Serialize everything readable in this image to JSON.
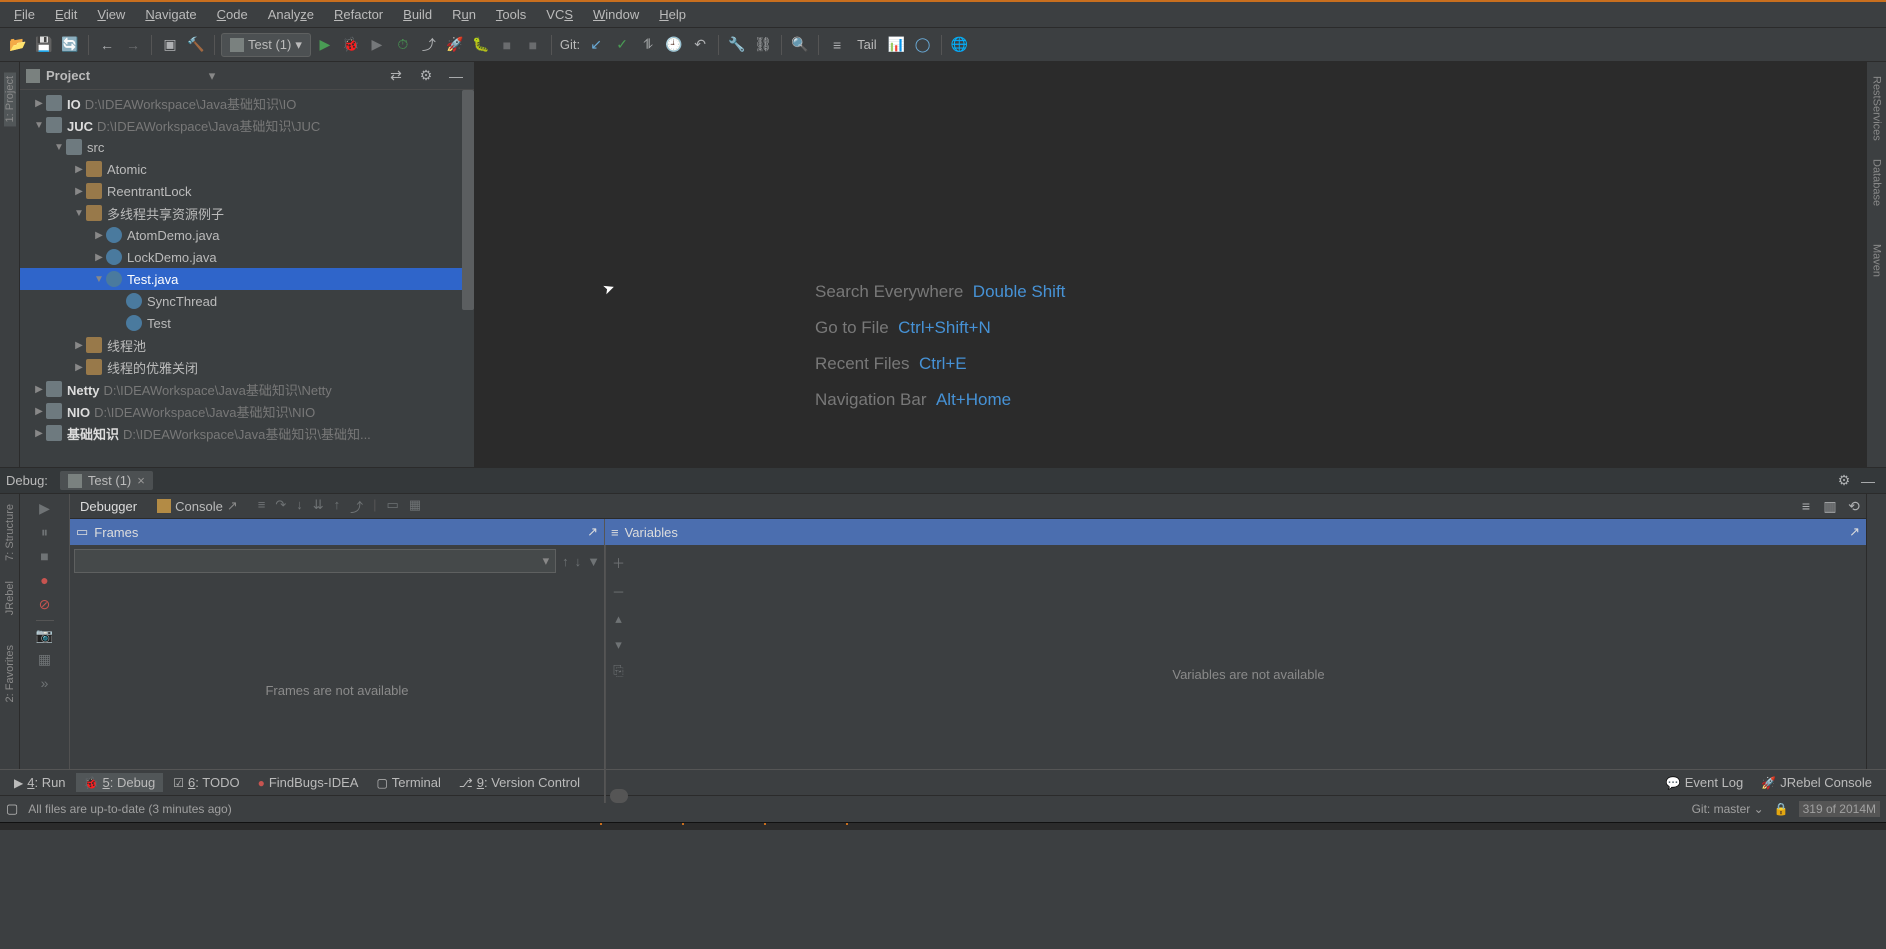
{
  "menu": [
    "File",
    "Edit",
    "View",
    "Navigate",
    "Code",
    "Analyze",
    "Refactor",
    "Build",
    "Run",
    "Tools",
    "VCS",
    "Window",
    "Help"
  ],
  "runConfig": {
    "label": "Test (1)"
  },
  "toolbar": {
    "gitLabel": "Git:",
    "tailLabel": "Tail"
  },
  "projectPanel": {
    "title": "Project"
  },
  "tree": [
    {
      "indent": 0,
      "arrow": "▶",
      "icon": "module",
      "bold": "IO",
      "path": "D:\\IDEAWorkspace\\Java基础知识\\IO"
    },
    {
      "indent": 0,
      "arrow": "▼",
      "icon": "module",
      "bold": "JUC",
      "path": "D:\\IDEAWorkspace\\Java基础知识\\JUC"
    },
    {
      "indent": 1,
      "arrow": "▼",
      "icon": "module",
      "bold": "",
      "label": "src"
    },
    {
      "indent": 2,
      "arrow": "▶",
      "icon": "pkg",
      "label": "Atomic"
    },
    {
      "indent": 2,
      "arrow": "▶",
      "icon": "pkg",
      "label": "ReentrantLock"
    },
    {
      "indent": 2,
      "arrow": "▼",
      "icon": "pkg",
      "label": "多线程共享资源例子"
    },
    {
      "indent": 3,
      "arrow": "▶",
      "icon": "java",
      "label": "AtomDemo.java"
    },
    {
      "indent": 3,
      "arrow": "▶",
      "icon": "java",
      "label": "LockDemo.java"
    },
    {
      "indent": 3,
      "arrow": "▼",
      "icon": "java",
      "label": "Test.java",
      "selected": true
    },
    {
      "indent": 4,
      "arrow": "",
      "icon": "java",
      "label": "SyncThread"
    },
    {
      "indent": 4,
      "arrow": "",
      "icon": "java",
      "label": "Test"
    },
    {
      "indent": 2,
      "arrow": "▶",
      "icon": "pkg",
      "label": "线程池"
    },
    {
      "indent": 2,
      "arrow": "▶",
      "icon": "pkg",
      "label": "线程的优雅关闭"
    },
    {
      "indent": 0,
      "arrow": "▶",
      "icon": "module",
      "bold": "Netty",
      "path": "D:\\IDEAWorkspace\\Java基础知识\\Netty"
    },
    {
      "indent": 0,
      "arrow": "▶",
      "icon": "module",
      "bold": "NIO",
      "path": "D:\\IDEAWorkspace\\Java基础知识\\NIO"
    },
    {
      "indent": 0,
      "arrow": "▶",
      "icon": "module",
      "bold": "基础知识",
      "path": "D:\\IDEAWorkspace\\Java基础知识\\基础知..."
    }
  ],
  "hints": [
    {
      "label": "Search Everywhere",
      "shortcut": "Double Shift"
    },
    {
      "label": "Go to File",
      "shortcut": "Ctrl+Shift+N"
    },
    {
      "label": "Recent Files",
      "shortcut": "Ctrl+E"
    },
    {
      "label": "Navigation Bar",
      "shortcut": "Alt+Home"
    }
  ],
  "debug": {
    "title": "Debug:",
    "tabLabel": "Test (1)",
    "debuggerTab": "Debugger",
    "consoleTab": "Console",
    "framesTitle": "Frames",
    "variablesTitle": "Variables",
    "framesEmpty": "Frames are not available",
    "varsEmpty": "Variables are not available"
  },
  "leftGutter": {
    "project": "1: Project"
  },
  "rightGutter": {
    "restServices": "RestServices",
    "database": "Database",
    "maven": "Maven"
  },
  "sideGutters": {
    "structure": "7: Structure",
    "jrebel": "JRebel",
    "favorites": "2: Favorites"
  },
  "bottomBar": {
    "run": "4: Run",
    "debug": "5: Debug",
    "todo": "6: TODO",
    "findbugs": "FindBugs-IDEA",
    "terminal": "Terminal",
    "vcs": "9: Version Control",
    "eventLog": "Event Log",
    "jrebelConsole": "JRebel Console"
  },
  "status": {
    "message": "All files are up-to-date (3 minutes ago)",
    "branch": "Git: master",
    "mem": "319 of 2014M"
  }
}
